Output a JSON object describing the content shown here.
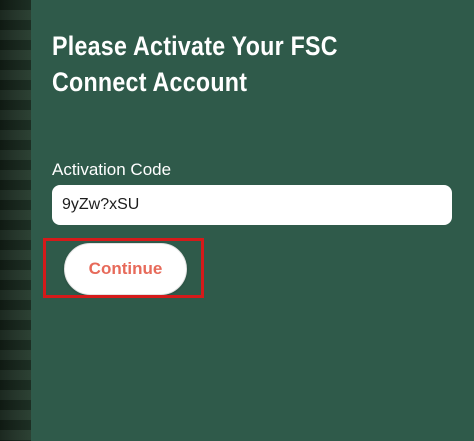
{
  "activation": {
    "title": "Please Activate Your FSC Connect Account",
    "code_label": "Activation Code",
    "code_value": "9yZw?xSU",
    "continue_label": "Continue"
  },
  "colors": {
    "panel_bg": "#2f5a4a",
    "button_text": "#e76a5a",
    "highlight_border": "#d51a1a"
  }
}
